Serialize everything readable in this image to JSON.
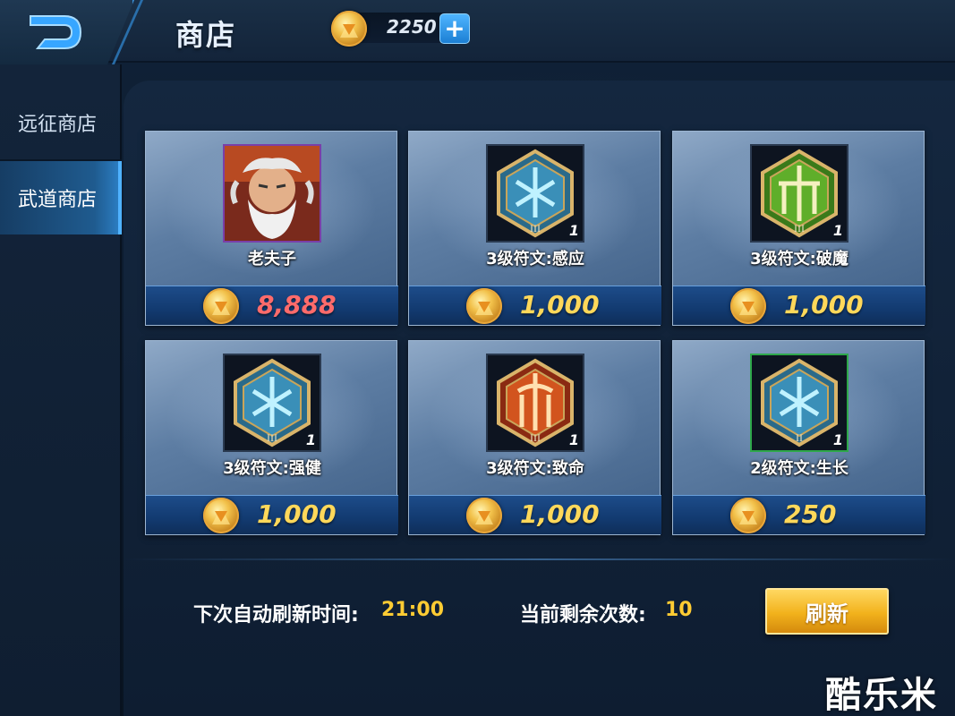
{
  "header": {
    "title": "商店",
    "gold_amount": "2250",
    "add_gold_label": "+"
  },
  "sidebar": {
    "items": [
      {
        "label": "远征商店",
        "active": false
      },
      {
        "label": "武道商店",
        "active": true
      }
    ]
  },
  "shop_items": [
    {
      "name": "老夫子",
      "price": "8,888",
      "price_color": "#ff6b6b",
      "icon": "hero-portrait-icon",
      "count": ""
    },
    {
      "name": "3级符文:感应",
      "price": "1,000",
      "price_color": "#ffd85a",
      "icon": "blue-rune-icon",
      "count": "1"
    },
    {
      "name": "3级符文:破魔",
      "price": "1,000",
      "price_color": "#ffd85a",
      "icon": "green-rune-icon",
      "count": "1"
    },
    {
      "name": "3级符文:强健",
      "price": "1,000",
      "price_color": "#ffd85a",
      "icon": "blue-rune-icon",
      "count": "1"
    },
    {
      "name": "3级符文:致命",
      "price": "1,000",
      "price_color": "#ffd85a",
      "icon": "red-rune-icon",
      "count": "1"
    },
    {
      "name": "2级符文:生长",
      "price": "250",
      "price_color": "#ffd85a",
      "icon": "blue-rune-icon",
      "count": "1"
    }
  ],
  "footer": {
    "next_refresh_label": "下次自动刷新时间:",
    "next_refresh_time": "21:00",
    "remaining_label": "当前剩余次数:",
    "remaining_count": "10",
    "refresh_button": "刷新"
  },
  "watermark": "酷乐米",
  "colors": {
    "accent_blue": "#2e7fc4",
    "gold": "#ffcc33",
    "price_red": "#ff6b6b"
  }
}
